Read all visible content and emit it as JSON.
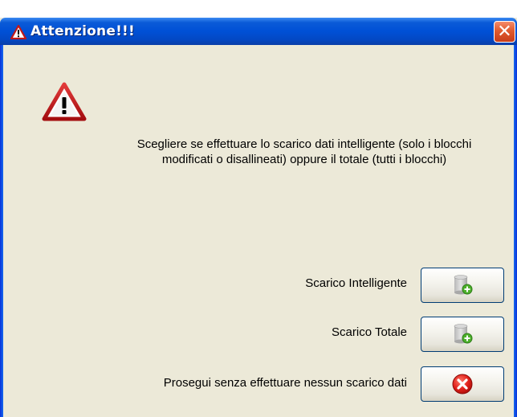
{
  "window": {
    "title": "Attenzione!!!",
    "close_glyph": "✕"
  },
  "message": "Scegliere se effettuare lo scarico dati intelligente (solo i blocchi modificati o disallineati) oppure il totale (tutti i blocchi)",
  "options": [
    {
      "label": "Scarico Intelligente",
      "icon": "database-add-icon"
    },
    {
      "label": "Scarico Totale",
      "icon": "database-add-icon"
    },
    {
      "label": "Prosegui senza effettuare nessun scarico dati",
      "icon": "red-x-icon"
    }
  ],
  "colors": {
    "titlebar": "#0050d6",
    "dialog_bg": "#ece9d8",
    "close_button": "#e05a2e"
  }
}
